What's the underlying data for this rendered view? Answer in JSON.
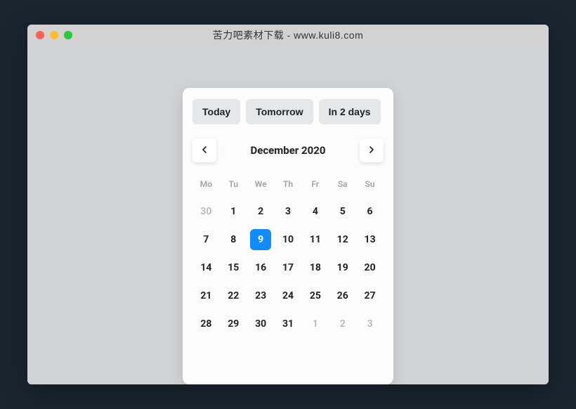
{
  "window": {
    "title": "苦力吧素材下载 - www.kuli8.com"
  },
  "datepicker": {
    "quick": {
      "today": "Today",
      "tomorrow": "Tomorrow",
      "in2days": "In 2 days"
    },
    "month_label": "December 2020",
    "weekdays": [
      "Mo",
      "Tu",
      "We",
      "Th",
      "Fr",
      "Sa",
      "Su"
    ],
    "days": [
      {
        "n": "30",
        "outside": true,
        "selected": false
      },
      {
        "n": "1",
        "outside": false,
        "selected": false
      },
      {
        "n": "2",
        "outside": false,
        "selected": false
      },
      {
        "n": "3",
        "outside": false,
        "selected": false
      },
      {
        "n": "4",
        "outside": false,
        "selected": false
      },
      {
        "n": "5",
        "outside": false,
        "selected": false
      },
      {
        "n": "6",
        "outside": false,
        "selected": false
      },
      {
        "n": "7",
        "outside": false,
        "selected": false
      },
      {
        "n": "8",
        "outside": false,
        "selected": false
      },
      {
        "n": "9",
        "outside": false,
        "selected": true
      },
      {
        "n": "10",
        "outside": false,
        "selected": false
      },
      {
        "n": "11",
        "outside": false,
        "selected": false
      },
      {
        "n": "12",
        "outside": false,
        "selected": false
      },
      {
        "n": "13",
        "outside": false,
        "selected": false
      },
      {
        "n": "14",
        "outside": false,
        "selected": false
      },
      {
        "n": "15",
        "outside": false,
        "selected": false
      },
      {
        "n": "16",
        "outside": false,
        "selected": false
      },
      {
        "n": "17",
        "outside": false,
        "selected": false
      },
      {
        "n": "18",
        "outside": false,
        "selected": false
      },
      {
        "n": "19",
        "outside": false,
        "selected": false
      },
      {
        "n": "20",
        "outside": false,
        "selected": false
      },
      {
        "n": "21",
        "outside": false,
        "selected": false
      },
      {
        "n": "22",
        "outside": false,
        "selected": false
      },
      {
        "n": "23",
        "outside": false,
        "selected": false
      },
      {
        "n": "24",
        "outside": false,
        "selected": false
      },
      {
        "n": "25",
        "outside": false,
        "selected": false
      },
      {
        "n": "26",
        "outside": false,
        "selected": false
      },
      {
        "n": "27",
        "outside": false,
        "selected": false
      },
      {
        "n": "28",
        "outside": false,
        "selected": false
      },
      {
        "n": "29",
        "outside": false,
        "selected": false
      },
      {
        "n": "30",
        "outside": false,
        "selected": false
      },
      {
        "n": "31",
        "outside": false,
        "selected": false
      },
      {
        "n": "1",
        "outside": true,
        "selected": false
      },
      {
        "n": "2",
        "outside": true,
        "selected": false
      },
      {
        "n": "3",
        "outside": true,
        "selected": false
      }
    ]
  }
}
